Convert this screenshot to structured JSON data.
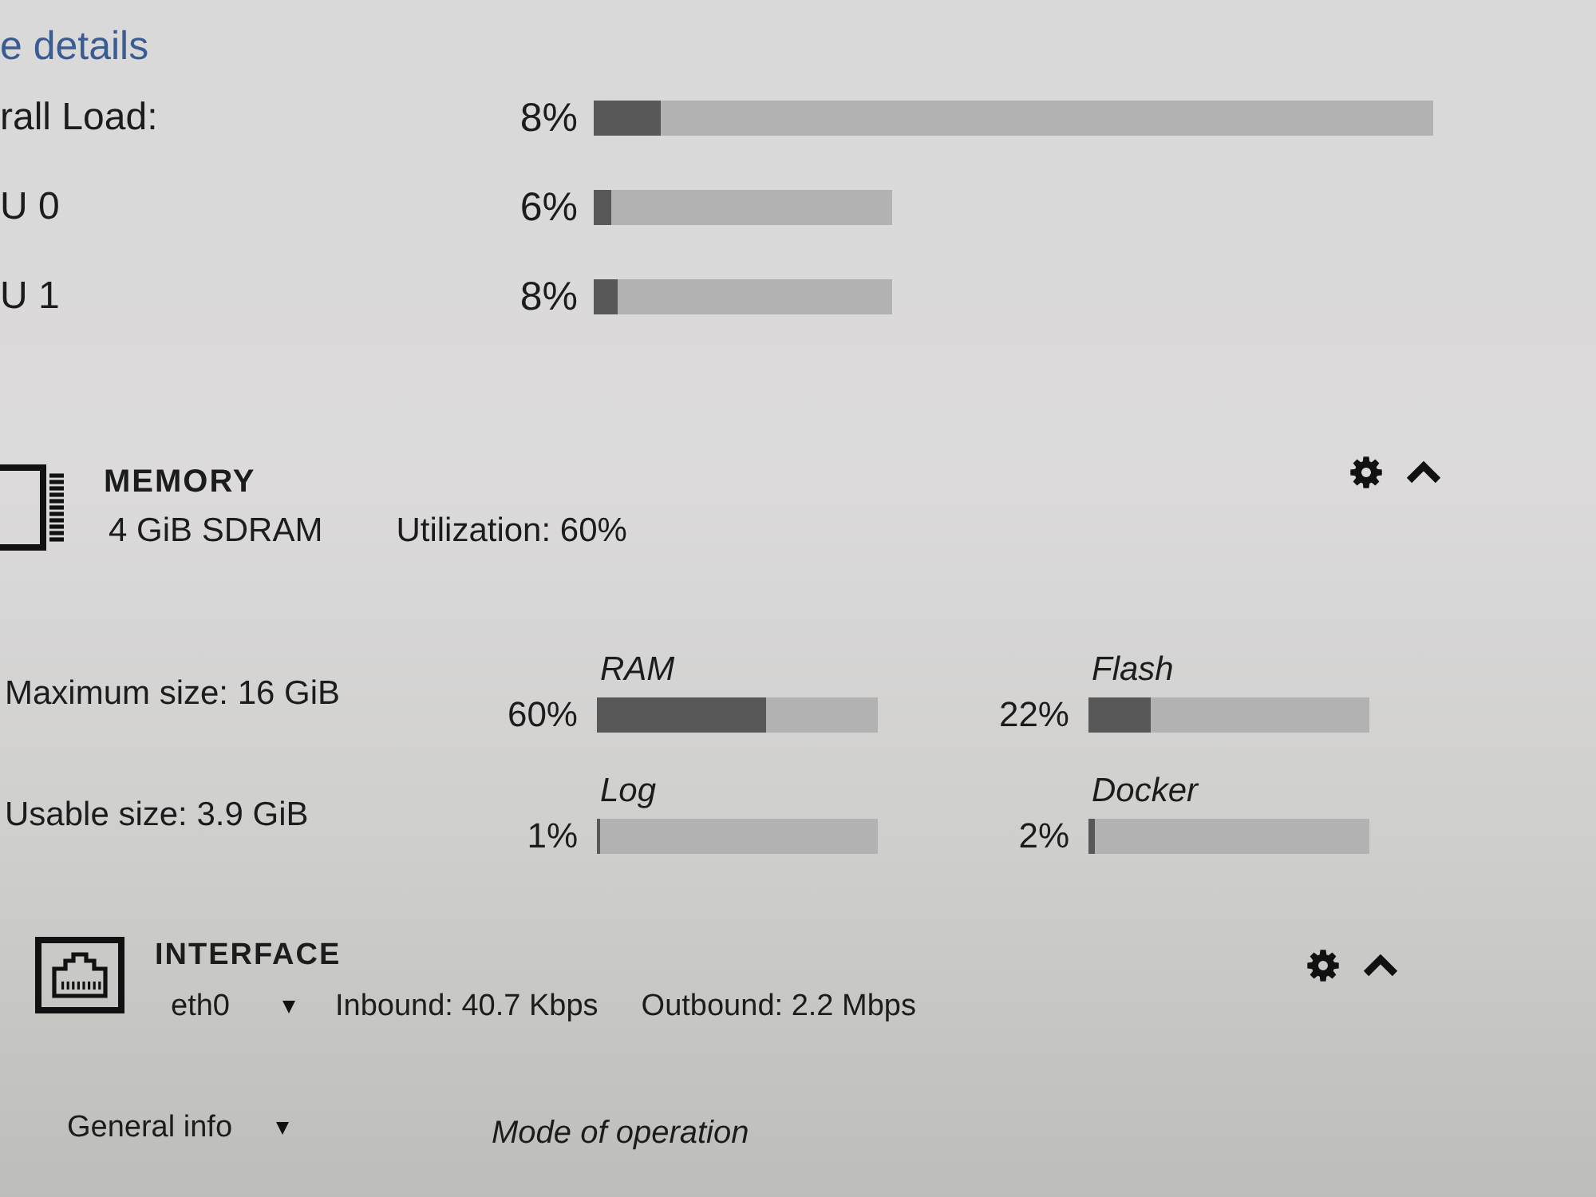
{
  "details_link": {
    "label": "e details"
  },
  "cpu": {
    "rows": [
      {
        "kind": "overall",
        "label": "rall Load:",
        "reading": "8%",
        "level": 0.08
      },
      {
        "kind": "core",
        "label": "U 0",
        "reading": "6%",
        "level": 0.06
      },
      {
        "kind": "core",
        "label": "U 1",
        "reading": "8%",
        "level": 0.08
      }
    ]
  },
  "memory": {
    "title": "MEMORY",
    "type": "4 GiB SDRAM",
    "utilization": "Utilization: 60%",
    "expanded": true,
    "details": [
      {
        "label": "Maximum size: 16 GiB",
        "meters": [
          {
            "label": "RAM",
            "reading": "60%",
            "level": 0.6
          },
          {
            "label": "Flash",
            "reading": "22%",
            "level": 0.22
          }
        ]
      },
      {
        "label": "Usable size: 3.9 GiB",
        "meters": [
          {
            "label": "Log",
            "reading": "1%",
            "level": 0.01
          },
          {
            "label": "Docker",
            "reading": "2%",
            "level": 0.02
          }
        ]
      }
    ]
  },
  "interface": {
    "title": "INTERFACE",
    "selected_interface": "eth0",
    "inbound": "Inbound: 40.7 Kbps",
    "outbound": "Outbound: 2.2 Mbps",
    "expanded": true
  },
  "sections": [
    {
      "kind": "dropdown",
      "label": "General info"
    },
    {
      "kind": "heading",
      "label": "Mode of operation"
    }
  ]
}
